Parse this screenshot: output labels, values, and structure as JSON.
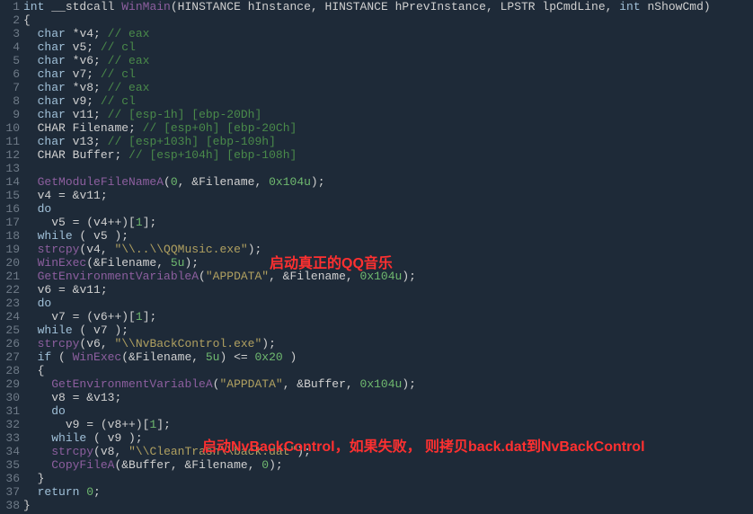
{
  "tokens": {
    "int": "int",
    "stdcall": "__stdcall",
    "WinMain": "WinMain",
    "HINSTANCE": "HINSTANCE",
    "hInstance": "hInstance",
    "hPrevInstance": "hPrevInstance",
    "LPSTR": "LPSTR",
    "lpCmdLine": "lpCmdLine",
    "nShowCmd": "nShowCmd",
    "char": "char",
    "CHAR": "CHAR",
    "v4": "v4",
    "v5": "v5",
    "v6": "v6",
    "v7": "v7",
    "v8": "v8",
    "v9": "v9",
    "v11": "v11",
    "v13": "v13",
    "Filename": "Filename",
    "Buffer": "Buffer",
    "cmt_eax": "// eax",
    "cmt_cl": "// cl",
    "cmt_esp1h": "// [esp-1h] [ebp-20Dh]",
    "cmt_esp0h": "// [esp+0h] [ebp-20Ch]",
    "cmt_esp103": "// [esp+103h] [ebp-109h]",
    "cmt_esp104": "// [esp+104h] [ebp-108h]",
    "GetModuleFileNameA": "GetModuleFileNameA",
    "GetEnvironmentVariableA": "GetEnvironmentVariableA",
    "WinExec": "WinExec",
    "strcpy": "strcpy",
    "CopyFileA": "CopyFileA",
    "do": "do",
    "while": "while",
    "if": "if",
    "return": "return",
    "appdata": "\"APPDATA\"",
    "qqmusic": "\"\\\\..\\\\QQMusic.exe\"",
    "nvback": "\"\\\\NvBackControl.exe\"",
    "cleantrash": "\"\\\\CleanTrash\\\\back.dat\"",
    "hex104": "0x104u",
    "hex20": "0x20",
    "five": "5u",
    "zero": "0",
    "one": "1"
  },
  "annot1": "启动真正的QQ音乐",
  "annot2": "启动NvBackControl，如果失败， 则拷贝back.dat到NvBackControl",
  "lines": [
    1,
    2,
    3,
    4,
    5,
    6,
    7,
    8,
    9,
    10,
    11,
    12,
    13,
    14,
    15,
    16,
    17,
    18,
    19,
    20,
    21,
    22,
    23,
    24,
    25,
    26,
    27,
    28,
    29,
    30,
    31,
    32,
    33,
    34,
    35,
    36,
    37,
    38
  ]
}
